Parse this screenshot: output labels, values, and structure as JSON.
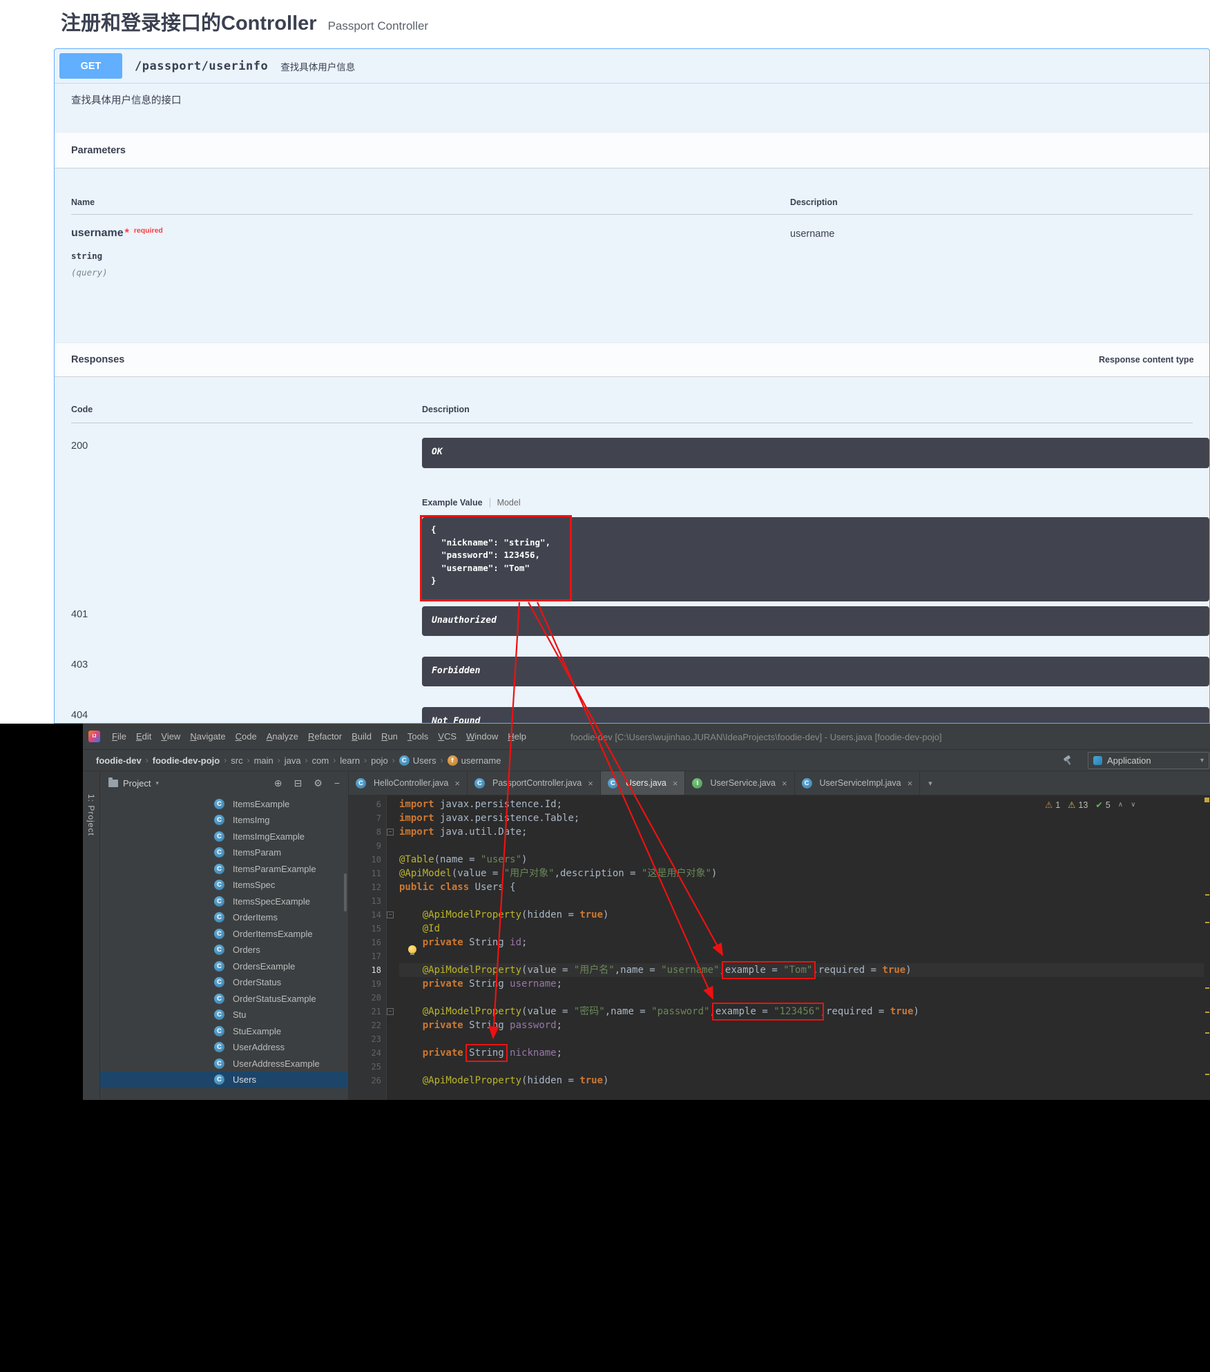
{
  "accent": {
    "red": "#ee1111",
    "get_blue": "#61affe",
    "dark_box": "#41444e"
  },
  "icons": {
    "class_letter": "C",
    "interface_letter": "I",
    "field_letter": "f",
    "chevron": "›",
    "dropdown": "▾",
    "close": "×",
    "gear": "⚙",
    "locate": "⊕",
    "collapse": "⊟",
    "hide": "−",
    "warning": "⚠",
    "check": "✔",
    "up": "∧",
    "down": "∨",
    "fold_minus": "−",
    "logo_text": "IJ"
  },
  "swagger": {
    "title": "注册和登录接口的Controller",
    "subtitle": "Passport Controller",
    "endpoint": {
      "method": "GET",
      "path": "/passport/userinfo",
      "summary": "查找具体用户信息",
      "description": "查找具体用户信息的接口"
    },
    "parameters": {
      "title": "Parameters",
      "name_header": "Name",
      "description_header": "Description",
      "param_name": "username",
      "param_star": "*",
      "param_required": "required",
      "param_type": "string",
      "param_in": "(query)",
      "param_description": "username"
    },
    "responses": {
      "title": "Responses",
      "content_type_label": "Response content type",
      "code_header": "Code",
      "description_header": "Description",
      "tabs": {
        "example": "Example Value",
        "model": "Model"
      },
      "example_json": "{\n  \"nickname\": \"string\",\n  \"password\": 123456,\n  \"username\": \"Tom\"\n}",
      "rows": [
        {
          "code": "200",
          "description": "OK"
        },
        {
          "code": "401",
          "description": "Unauthorized"
        },
        {
          "code": "403",
          "description": "Forbidden"
        },
        {
          "code": "404",
          "description": "Not Found"
        }
      ]
    }
  },
  "ide": {
    "menu": [
      "File",
      "Edit",
      "View",
      "Navigate",
      "Code",
      "Analyze",
      "Refactor",
      "Build",
      "Run",
      "Tools",
      "VCS",
      "Window",
      "Help"
    ],
    "window_title": "foodie-dev [C:\\Users\\wujinhao.JURAN\\IdeaProjects\\foodie-dev] - Users.java [foodie-dev-pojo]",
    "breadcrumbs": [
      {
        "label": "foodie-dev",
        "bold": true
      },
      {
        "label": "foodie-dev-pojo",
        "bold": true
      },
      {
        "label": "src"
      },
      {
        "label": "main"
      },
      {
        "label": "java"
      },
      {
        "label": "com"
      },
      {
        "label": "learn"
      },
      {
        "label": "pojo"
      },
      {
        "label": "Users",
        "icon": "class"
      },
      {
        "label": "username",
        "icon": "field"
      }
    ],
    "run_config": "Application",
    "project_panel": {
      "stripe_label": "1: Project",
      "title": "Project"
    },
    "tabs": [
      {
        "label": "HelloController.java",
        "icon": "class"
      },
      {
        "label": "PassportController.java",
        "icon": "class"
      },
      {
        "label": "Users.java",
        "icon": "class",
        "active": true
      },
      {
        "label": "UserService.java",
        "icon": "interface"
      },
      {
        "label": "UserServiceImpl.java",
        "icon": "class"
      }
    ],
    "tree": [
      "ItemsExample",
      "ItemsImg",
      "ItemsImgExample",
      "ItemsParam",
      "ItemsParamExample",
      "ItemsSpec",
      "ItemsSpecExample",
      "OrderItems",
      "OrderItemsExample",
      "Orders",
      "OrdersExample",
      "OrderStatus",
      "OrderStatusExample",
      "Stu",
      "StuExample",
      "UserAddress",
      "UserAddressExample",
      "Users"
    ],
    "tree_selected": "Users",
    "inspections": {
      "warn_a": "1",
      "warn_b": "13",
      "ok": "5"
    },
    "code": [
      {
        "n": 6,
        "t": [
          [
            "k",
            "import"
          ],
          [
            "p",
            " javax.persistence.Id;"
          ]
        ]
      },
      {
        "n": 7,
        "t": [
          [
            "k",
            "import"
          ],
          [
            "p",
            " javax.persistence.Table;"
          ]
        ]
      },
      {
        "n": 8,
        "fold": true,
        "t": [
          [
            "k",
            "import"
          ],
          [
            "p",
            " java.util.Date;"
          ]
        ]
      },
      {
        "n": 9,
        "t": []
      },
      {
        "n": 10,
        "t": [
          [
            "a",
            "@Table"
          ],
          [
            "p",
            "(name = "
          ],
          [
            "s",
            "\"users\""
          ],
          [
            "p",
            ")"
          ]
        ]
      },
      {
        "n": 11,
        "t": [
          [
            "a",
            "@ApiModel"
          ],
          [
            "p",
            "(value = "
          ],
          [
            "s",
            "\"用户对象\""
          ],
          [
            "p",
            ",description = "
          ],
          [
            "s",
            "\"这是用户对象\""
          ],
          [
            "p",
            ")"
          ]
        ]
      },
      {
        "n": 12,
        "t": [
          [
            "k",
            "public class "
          ],
          [
            "p",
            "Users {"
          ]
        ]
      },
      {
        "n": 13,
        "t": []
      },
      {
        "n": 14,
        "fold": true,
        "t": [
          [
            "p",
            "    "
          ],
          [
            "a",
            "@ApiModelProperty"
          ],
          [
            "p",
            "(hidden = "
          ],
          [
            "k",
            "true"
          ],
          [
            "p",
            ")"
          ]
        ]
      },
      {
        "n": 15,
        "t": [
          [
            "p",
            "    "
          ],
          [
            "a",
            "@Id"
          ]
        ]
      },
      {
        "n": 16,
        "t": [
          [
            "p",
            "    "
          ],
          [
            "k",
            "private "
          ],
          [
            "p",
            "String "
          ],
          [
            "f",
            "id"
          ],
          [
            "p",
            ";"
          ]
        ]
      },
      {
        "n": 17,
        "t": []
      },
      {
        "n": 18,
        "cur": true,
        "t": [
          [
            "p",
            "    "
          ],
          [
            "a",
            "@ApiModelProperty"
          ],
          [
            "p",
            "(value = "
          ],
          [
            "s",
            "\"用户名\""
          ],
          [
            "p",
            ",name = "
          ],
          [
            "s",
            "\"username\""
          ],
          [
            "p",
            ","
          ],
          {
            "box": [
              [
                "p",
                "example = "
              ],
              [
                "s",
                "\"Tom\""
              ]
            ]
          },
          [
            "p",
            ",required = "
          ],
          [
            "k",
            "true"
          ],
          [
            "p",
            ")"
          ]
        ]
      },
      {
        "n": 19,
        "t": [
          [
            "p",
            "    "
          ],
          [
            "k",
            "private "
          ],
          [
            "p",
            "String "
          ],
          [
            "f",
            "username"
          ],
          [
            "p",
            ";"
          ]
        ]
      },
      {
        "n": 20,
        "t": []
      },
      {
        "n": 21,
        "fold": true,
        "t": [
          [
            "p",
            "    "
          ],
          [
            "a",
            "@ApiModelProperty"
          ],
          [
            "p",
            "(value = "
          ],
          [
            "s",
            "\"密码\""
          ],
          [
            "p",
            ",name = "
          ],
          [
            "s",
            "\"password\""
          ],
          [
            "p",
            ","
          ],
          {
            "box": [
              [
                "p",
                "example = "
              ],
              [
                "s",
                "\"123456\""
              ]
            ]
          },
          [
            "p",
            ",required = "
          ],
          [
            "k",
            "true"
          ],
          [
            "p",
            ")"
          ]
        ]
      },
      {
        "n": 22,
        "t": [
          [
            "p",
            "    "
          ],
          [
            "k",
            "private "
          ],
          [
            "p",
            "String "
          ],
          [
            "f",
            "password"
          ],
          [
            "p",
            ";"
          ]
        ]
      },
      {
        "n": 23,
        "t": []
      },
      {
        "n": 24,
        "t": [
          [
            "p",
            "    "
          ],
          [
            "k",
            "private "
          ],
          {
            "box": [
              [
                "p",
                "String"
              ]
            ]
          },
          [
            "p",
            " "
          ],
          [
            "f",
            "nickname"
          ],
          [
            "p",
            ";"
          ]
        ]
      },
      {
        "n": 25,
        "t": []
      },
      {
        "n": 26,
        "t": [
          [
            "p",
            "    "
          ],
          [
            "a",
            "@ApiModelProperty"
          ],
          [
            "p",
            "(hidden = "
          ],
          [
            "k",
            "true"
          ],
          [
            "p",
            ")"
          ]
        ]
      }
    ]
  }
}
